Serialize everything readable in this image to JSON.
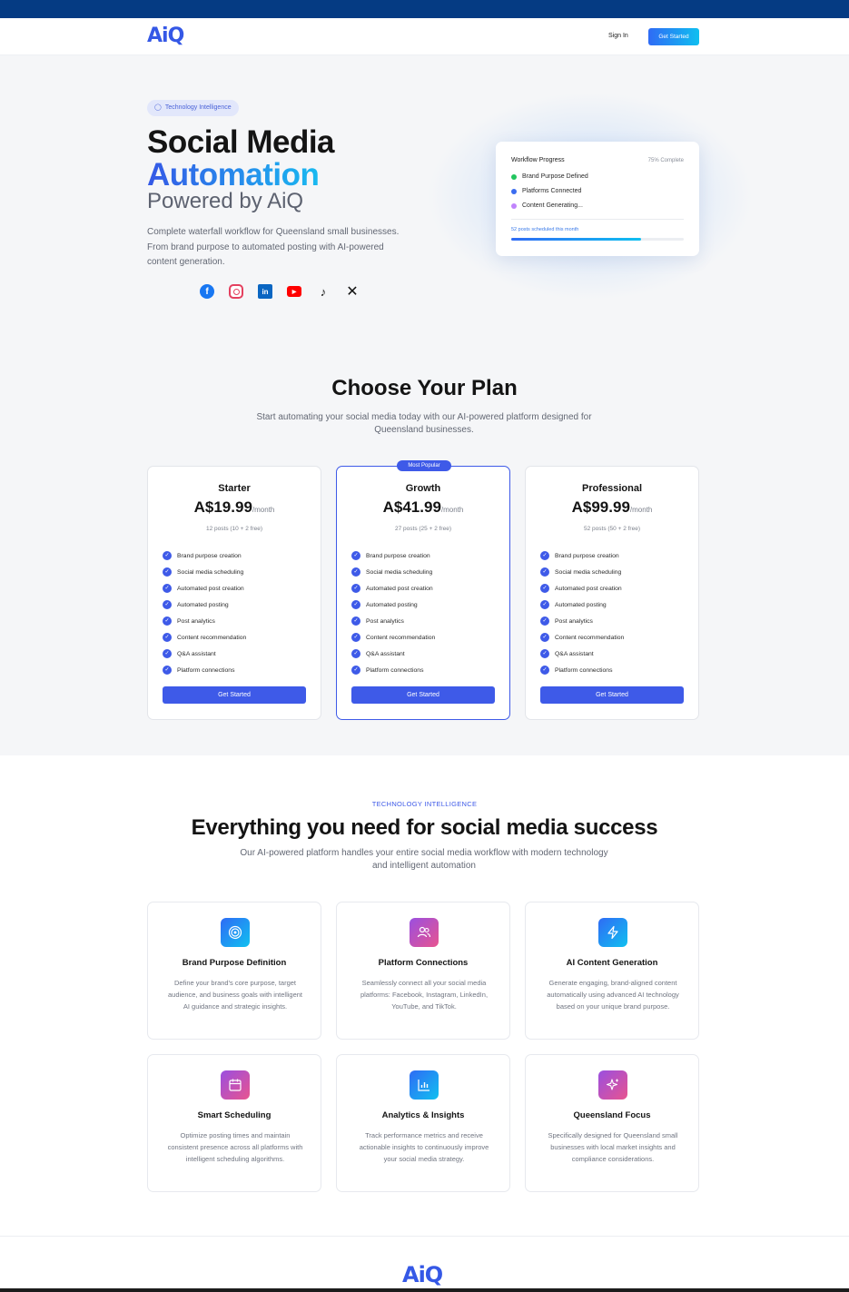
{
  "nav": {
    "logo": "AiQ",
    "sign_in": "Sign In",
    "get_started": "Get Started"
  },
  "hero": {
    "badge": "Technology Intelligence",
    "title_line1": "Social Media",
    "title_line2": "Automation",
    "title_line3": "Powered by AiQ",
    "description": "Complete waterfall workflow for Queensland small businesses. From brand purpose to automated posting with AI-powered content generation.",
    "socials": [
      "facebook-icon",
      "instagram-icon",
      "linkedin-icon",
      "youtube-icon",
      "tiktok-icon",
      "x-icon"
    ]
  },
  "workflow": {
    "title": "Workflow Progress",
    "percent_label": "75% Complete",
    "progress": 0.75,
    "items": [
      {
        "label": "Brand Purpose Defined",
        "color": "#22c55e"
      },
      {
        "label": "Platforms Connected",
        "color": "#3b6cf0"
      },
      {
        "label": "Content Generating...",
        "color": "#c084fc"
      }
    ],
    "scheduled": "52 posts scheduled this month"
  },
  "plans": {
    "title": "Choose Your Plan",
    "subtitle": "Start automating your social media today with our AI-powered platform designed for Queensland businesses.",
    "popular_badge": "Most Popular",
    "features": [
      "Brand purpose creation",
      "Social media scheduling",
      "Automated post creation",
      "Automated posting",
      "Post analytics",
      "Content recommendation",
      "Q&A assistant",
      "Platform connections"
    ],
    "items": [
      {
        "name": "Starter",
        "price": "A$19.99",
        "period": "/month",
        "posts": "12 posts (10 + 2 free)",
        "button": "Get Started"
      },
      {
        "name": "Growth",
        "price": "A$41.99",
        "period": "/month",
        "posts": "27 posts (25 + 2 free)",
        "button": "Get Started"
      },
      {
        "name": "Professional",
        "price": "A$99.99",
        "period": "/month",
        "posts": "52 posts (50 + 2 free)",
        "button": "Get Started"
      }
    ]
  },
  "features": {
    "eyebrow": "TECHNOLOGY INTELLIGENCE",
    "title": "Everything you need for social media success",
    "subtitle": "Our AI-powered platform handles your entire social media workflow with modern technology and intelligent automation",
    "cards": [
      {
        "icon": "target-icon",
        "title": "Brand Purpose Definition",
        "desc": "Define your brand's core purpose, target audience, and business goals with intelligent AI guidance and strategic insights."
      },
      {
        "icon": "users-icon",
        "title": "Platform Connections",
        "desc": "Seamlessly connect all your social media platforms: Facebook, Instagram, LinkedIn, YouTube, and TikTok."
      },
      {
        "icon": "lightning-icon",
        "title": "AI Content Generation",
        "desc": "Generate engaging, brand-aligned content automatically using advanced AI technology based on your unique brand purpose."
      },
      {
        "icon": "calendar-icon",
        "title": "Smart Scheduling",
        "desc": "Optimize posting times and maintain consistent presence across all platforms with intelligent scheduling algorithms."
      },
      {
        "icon": "chart-icon",
        "title": "Analytics & Insights",
        "desc": "Track performance metrics and receive actionable insights to continuously improve your social media strategy."
      },
      {
        "icon": "sparkles-icon",
        "title": "Queensland Focus",
        "desc": "Specifically designed for Queensland small businesses with local market insights and compliance considerations."
      }
    ]
  },
  "footer": {
    "logo": "AiQ"
  }
}
